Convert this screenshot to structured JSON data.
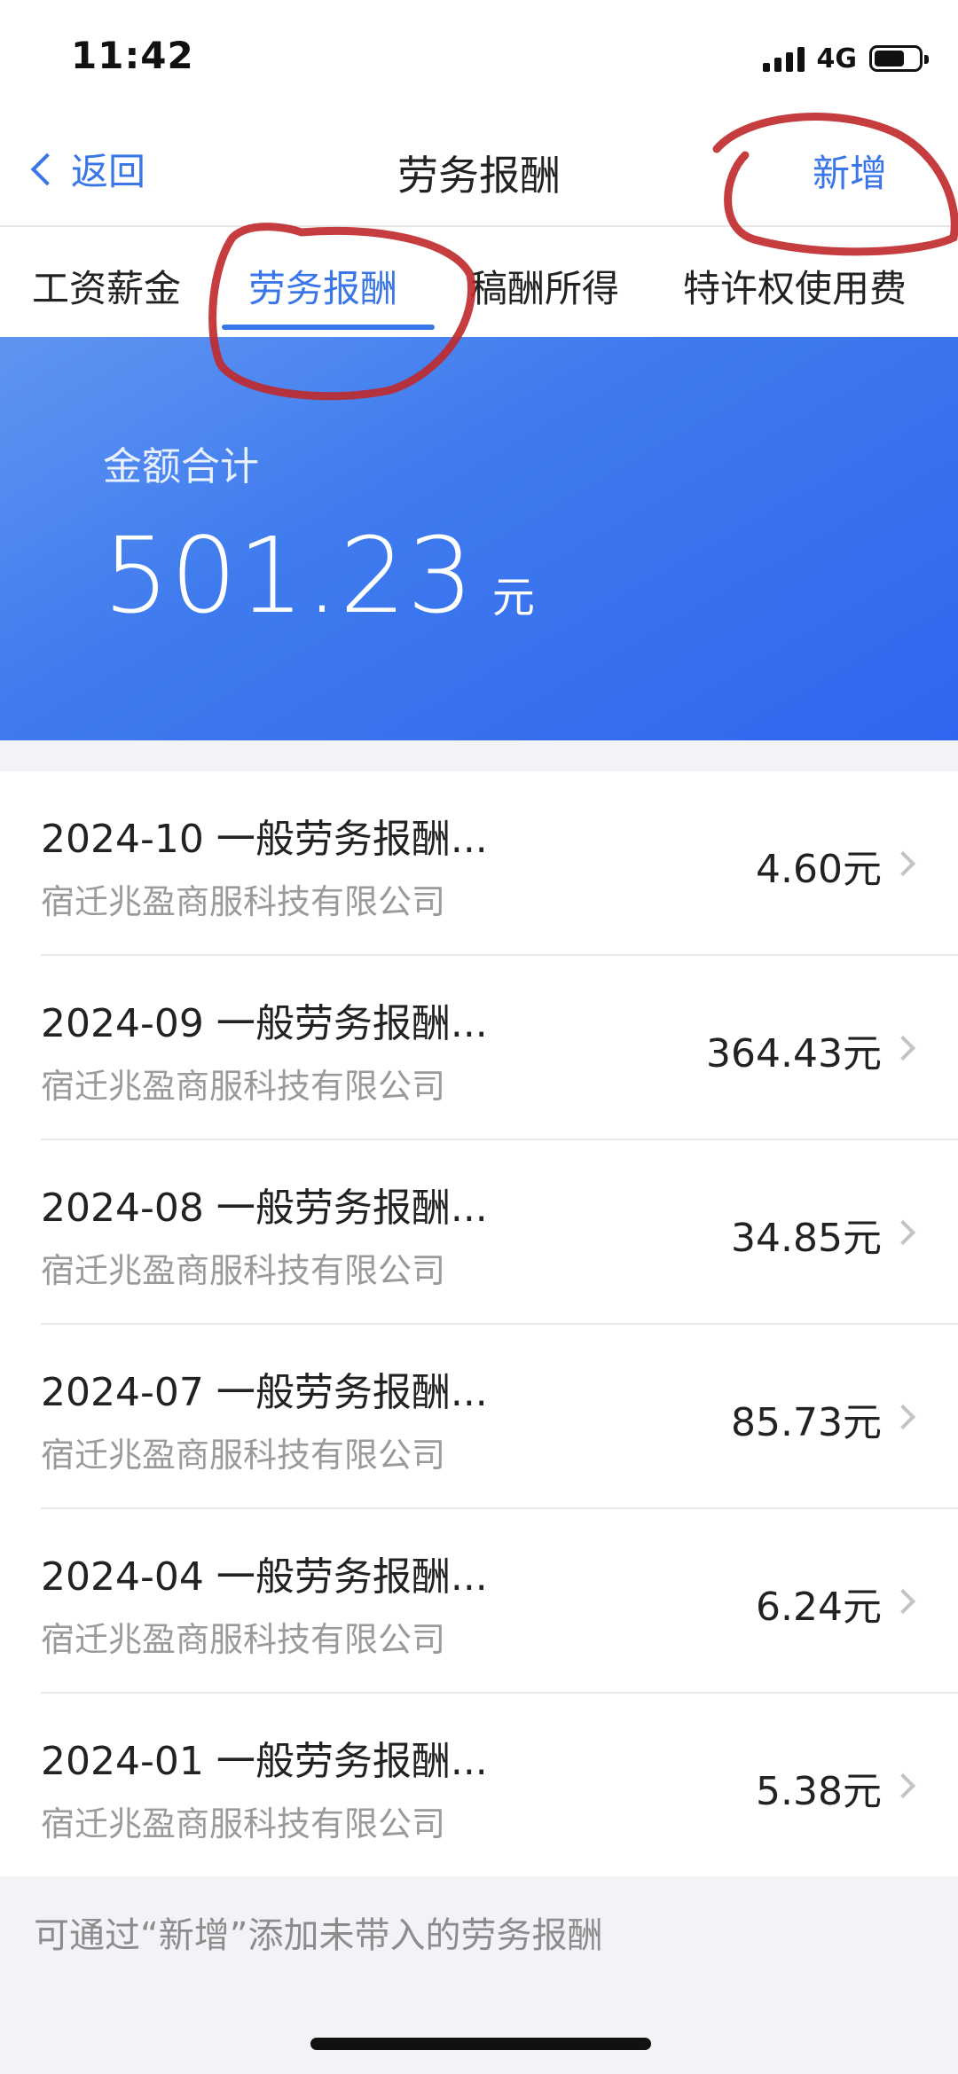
{
  "status": {
    "time": "11:42",
    "network": "4G"
  },
  "nav": {
    "back_label": "返回",
    "title": "劳务报酬",
    "add_label": "新增"
  },
  "tabs": [
    {
      "label": "工资薪金"
    },
    {
      "label": "劳务报酬"
    },
    {
      "label": "稿酬所得"
    },
    {
      "label": "特许权使用费"
    }
  ],
  "summary": {
    "label": "金额合计",
    "amount": "501.23",
    "unit": "元"
  },
  "records": [
    {
      "title": "2024-10 一般劳务报酬...",
      "company": "宿迁兆盈商服科技有限公司",
      "amount": "4.60元"
    },
    {
      "title": "2024-09 一般劳务报酬...",
      "company": "宿迁兆盈商服科技有限公司",
      "amount": "364.43元"
    },
    {
      "title": "2024-08 一般劳务报酬...",
      "company": "宿迁兆盈商服科技有限公司",
      "amount": "34.85元"
    },
    {
      "title": "2024-07 一般劳务报酬...",
      "company": "宿迁兆盈商服科技有限公司",
      "amount": "85.73元"
    },
    {
      "title": "2024-04 一般劳务报酬...",
      "company": "宿迁兆盈商服科技有限公司",
      "amount": "6.24元"
    },
    {
      "title": "2024-01 一般劳务报酬...",
      "company": "宿迁兆盈商服科技有限公司",
      "amount": "5.38元"
    }
  ],
  "footer": {
    "note": "可通过“新增”添加未带入的劳务报酬"
  },
  "colors": {
    "accent": "#3a76e8",
    "banner": "#3f7bee",
    "annotation": "#c0282a"
  }
}
